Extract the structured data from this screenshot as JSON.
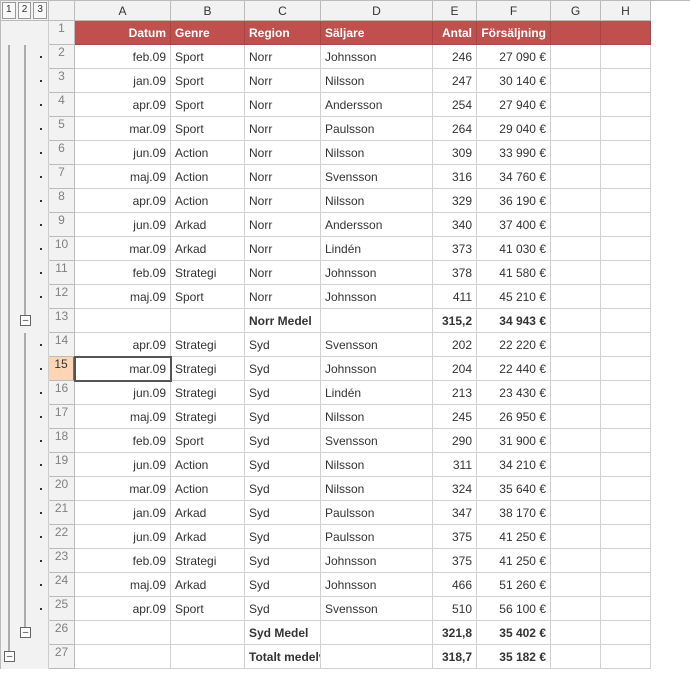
{
  "outlineLevels": [
    "1",
    "2",
    "3"
  ],
  "columns": [
    "A",
    "B",
    "C",
    "D",
    "E",
    "F",
    "G",
    "H"
  ],
  "header": {
    "A": "Datum",
    "B": "Genre",
    "C": "Region",
    "D": "Säljare",
    "E": "Antal",
    "F": "Försäljning"
  },
  "selectedRow": 15,
  "collapseGlyph": "–",
  "rows": [
    {
      "n": 1,
      "type": "header"
    },
    {
      "n": 2,
      "type": "data",
      "A": "feb.09",
      "B": "Sport",
      "C": "Norr",
      "D": "Johnsson",
      "E": "246",
      "F": "27 090 €"
    },
    {
      "n": 3,
      "type": "data",
      "A": "jan.09",
      "B": "Sport",
      "C": "Norr",
      "D": "Nilsson",
      "E": "247",
      "F": "30 140 €"
    },
    {
      "n": 4,
      "type": "data",
      "A": "apr.09",
      "B": "Sport",
      "C": "Norr",
      "D": "Andersson",
      "E": "254",
      "F": "27 940 €"
    },
    {
      "n": 5,
      "type": "data",
      "A": "mar.09",
      "B": "Sport",
      "C": "Norr",
      "D": "Paulsson",
      "E": "264",
      "F": "29 040 €"
    },
    {
      "n": 6,
      "type": "data",
      "A": "jun.09",
      "B": "Action",
      "C": "Norr",
      "D": "Nilsson",
      "E": "309",
      "F": "33 990 €"
    },
    {
      "n": 7,
      "type": "data",
      "A": "maj.09",
      "B": "Action",
      "C": "Norr",
      "D": "Svensson",
      "E": "316",
      "F": "34 760 €"
    },
    {
      "n": 8,
      "type": "data",
      "A": "apr.09",
      "B": "Action",
      "C": "Norr",
      "D": "Nilsson",
      "E": "329",
      "F": "36 190 €"
    },
    {
      "n": 9,
      "type": "data",
      "A": "jun.09",
      "B": "Arkad",
      "C": "Norr",
      "D": "Andersson",
      "E": "340",
      "F": "37 400 €"
    },
    {
      "n": 10,
      "type": "data",
      "A": "mar.09",
      "B": "Arkad",
      "C": "Norr",
      "D": "Lindén",
      "E": "373",
      "F": "41 030 €"
    },
    {
      "n": 11,
      "type": "data",
      "A": "feb.09",
      "B": "Strategi",
      "C": "Norr",
      "D": "Johnsson",
      "E": "378",
      "F": "41 580 €"
    },
    {
      "n": 12,
      "type": "data",
      "A": "maj.09",
      "B": "Sport",
      "C": "Norr",
      "D": "Johnsson",
      "E": "411",
      "F": "45 210 €"
    },
    {
      "n": 13,
      "type": "subtotal",
      "C": "Norr Medel",
      "E": "315,2",
      "F": "34 943 €"
    },
    {
      "n": 14,
      "type": "data",
      "A": "apr.09",
      "B": "Strategi",
      "C": "Syd",
      "D": "Svensson",
      "E": "202",
      "F": "22 220 €"
    },
    {
      "n": 15,
      "type": "data",
      "A": "mar.09",
      "B": "Strategi",
      "C": "Syd",
      "D": "Johnsson",
      "E": "204",
      "F": "22 440 €"
    },
    {
      "n": 16,
      "type": "data",
      "A": "jun.09",
      "B": "Strategi",
      "C": "Syd",
      "D": "Lindén",
      "E": "213",
      "F": "23 430 €"
    },
    {
      "n": 17,
      "type": "data",
      "A": "maj.09",
      "B": "Strategi",
      "C": "Syd",
      "D": "Nilsson",
      "E": "245",
      "F": "26 950 €"
    },
    {
      "n": 18,
      "type": "data",
      "A": "feb.09",
      "B": "Sport",
      "C": "Syd",
      "D": "Svensson",
      "E": "290",
      "F": "31 900 €"
    },
    {
      "n": 19,
      "type": "data",
      "A": "jun.09",
      "B": "Action",
      "C": "Syd",
      "D": "Nilsson",
      "E": "311",
      "F": "34 210 €"
    },
    {
      "n": 20,
      "type": "data",
      "A": "mar.09",
      "B": "Action",
      "C": "Syd",
      "D": "Nilsson",
      "E": "324",
      "F": "35 640 €"
    },
    {
      "n": 21,
      "type": "data",
      "A": "jan.09",
      "B": "Arkad",
      "C": "Syd",
      "D": "Paulsson",
      "E": "347",
      "F": "38 170 €"
    },
    {
      "n": 22,
      "type": "data",
      "A": "jun.09",
      "B": "Arkad",
      "C": "Syd",
      "D": "Paulsson",
      "E": "375",
      "F": "41 250 €"
    },
    {
      "n": 23,
      "type": "data",
      "A": "feb.09",
      "B": "Strategi",
      "C": "Syd",
      "D": "Johnsson",
      "E": "375",
      "F": "41 250 €"
    },
    {
      "n": 24,
      "type": "data",
      "A": "maj.09",
      "B": "Arkad",
      "C": "Syd",
      "D": "Johnsson",
      "E": "466",
      "F": "51 260 €"
    },
    {
      "n": 25,
      "type": "data",
      "A": "apr.09",
      "B": "Sport",
      "C": "Syd",
      "D": "Svensson",
      "E": "510",
      "F": "56 100 €"
    },
    {
      "n": 26,
      "type": "subtotal",
      "C": "Syd Medel",
      "E": "321,8",
      "F": "35 402 €"
    },
    {
      "n": 27,
      "type": "grandtotal",
      "C": "Totalt medelvärde",
      "E": "318,7",
      "F": "35 182 €"
    }
  ]
}
